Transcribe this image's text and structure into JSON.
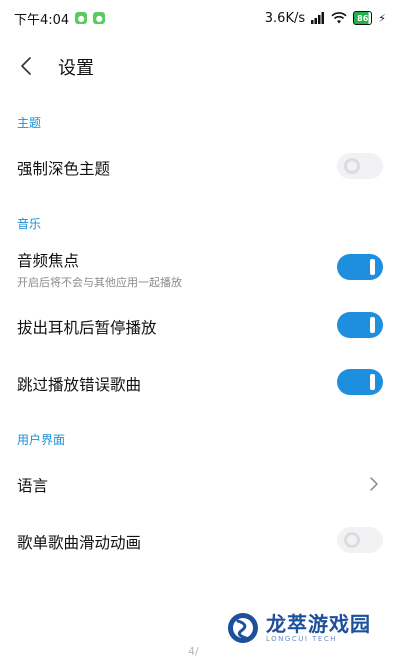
{
  "status_bar": {
    "time": "下午4:04",
    "network_speed": "3.6K/s",
    "battery_level": "86",
    "battery_fraction": 0.86,
    "notification_icons": [
      "wechat-icon",
      "wechat-icon"
    ]
  },
  "header": {
    "title": "设置"
  },
  "sections": {
    "theme": {
      "label": "主题",
      "items": [
        {
          "title": "强制深色主题",
          "control": "toggle",
          "enabled": false
        }
      ]
    },
    "music": {
      "label": "音乐",
      "items": [
        {
          "title": "音频焦点",
          "subtitle": "开启后将不会与其他应用一起播放",
          "control": "toggle",
          "enabled": true
        },
        {
          "title": "拔出耳机后暂停播放",
          "control": "toggle",
          "enabled": true
        },
        {
          "title": "跳过播放错误歌曲",
          "control": "toggle",
          "enabled": true
        }
      ]
    },
    "ui": {
      "label": "用户界面",
      "items": [
        {
          "title": "语言",
          "control": "chevron"
        },
        {
          "title": "歌单歌曲滑动动画",
          "control": "toggle",
          "enabled": false
        }
      ]
    }
  },
  "watermark": {
    "title": "龙萃游戏园",
    "subtitle": "LONGCUI TECH"
  },
  "page_hint": "4/",
  "colors": {
    "accent": "#1e8ede",
    "section_label": "#1a90d6",
    "toggle_off": "#f2f2f4"
  }
}
